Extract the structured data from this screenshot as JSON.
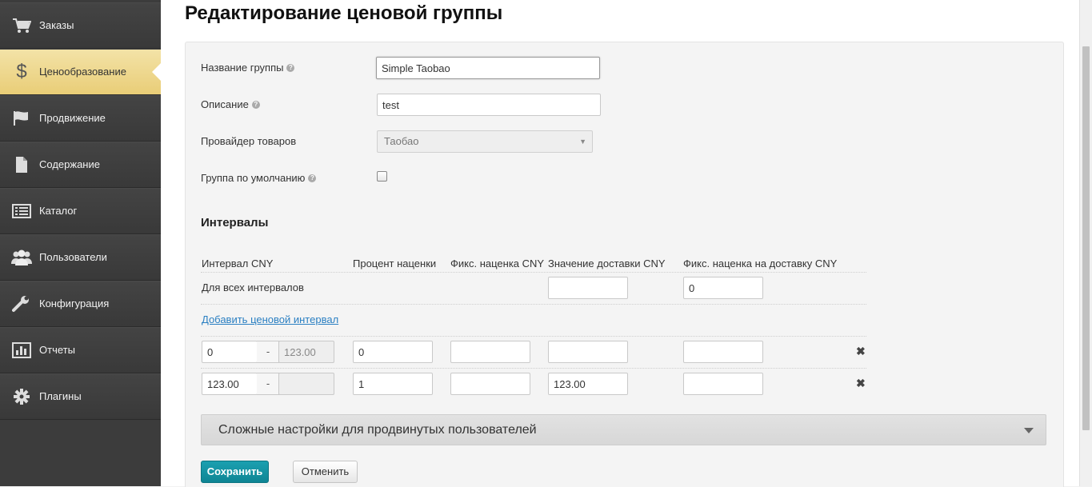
{
  "sidebar": {
    "items": [
      {
        "label": "Заказы",
        "icon": "cart-icon",
        "active": false
      },
      {
        "label": "Ценообразование",
        "icon": "dollar-icon",
        "active": true
      },
      {
        "label": "Продвижение",
        "icon": "flag-icon",
        "active": false
      },
      {
        "label": "Содержание",
        "icon": "document-icon",
        "active": false
      },
      {
        "label": "Каталог",
        "icon": "list-icon",
        "active": false
      },
      {
        "label": "Пользователи",
        "icon": "users-icon",
        "active": false
      },
      {
        "label": "Конфигурация",
        "icon": "wrench-icon",
        "active": false
      },
      {
        "label": "Отчеты",
        "icon": "chart-icon",
        "active": false
      },
      {
        "label": "Плагины",
        "icon": "gear-icon",
        "active": false
      }
    ],
    "active_color": "#eed98f"
  },
  "page": {
    "title": "Редактирование ценовой группы"
  },
  "form": {
    "group_name_label": "Название группы",
    "group_name_value": "Simple Taobao",
    "description_label": "Описание",
    "description_value": "test",
    "provider_label": "Провайдер товаров",
    "provider_value": "Таобао",
    "default_group_label": "Группа по умолчанию",
    "default_group_checked": false
  },
  "intervals": {
    "title": "Интервалы",
    "headers": [
      "Интервал CNY",
      "Процент наценки",
      "Фикс. наценка CNY",
      "Значение доставки CNY",
      "Фикс. наценка на доставку CNY"
    ],
    "all_label": "Для всех интервалов",
    "all_delivery": "",
    "all_delivery_fixed": "0",
    "add_link": "Добавить ценовой интервал",
    "rows": [
      {
        "from": "0",
        "sep": "-",
        "to": "123.00",
        "percent": "0",
        "fixed": "",
        "delivery": "",
        "delivery_fixed": ""
      },
      {
        "from": "123.00",
        "sep": "-",
        "to": "",
        "percent": "1",
        "fixed": "",
        "delivery": "123.00",
        "delivery_fixed": ""
      }
    ]
  },
  "advanced": {
    "title": "Сложные настройки для продвинутых пользователей"
  },
  "buttons": {
    "save": "Сохранить",
    "cancel": "Отменить"
  },
  "colors": {
    "primary": "#1396a6",
    "link": "#2a7fc2",
    "sidebar": "#3c3c3c"
  }
}
